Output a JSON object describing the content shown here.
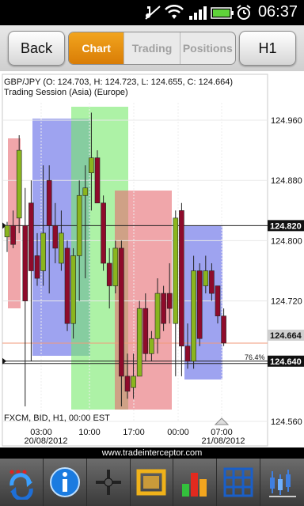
{
  "status": {
    "time": "06:37"
  },
  "toolbar": {
    "back_label": "Back",
    "tabs": [
      {
        "label": "Chart",
        "active": true
      },
      {
        "label": "Trading",
        "active": false
      },
      {
        "label": "Positions",
        "active": false
      }
    ],
    "timeframe_label": "H1"
  },
  "chart": {
    "header_line1": "GBP/JPY (O: 124.703, H: 124.723, L: 124.655, C: 124.664)",
    "header_line2": "Trading Session (Asia) (Europe)",
    "footer_label": "FXCM, BID, H1, 00:00 EST",
    "percent_label": "76.4%",
    "price_current": "124.664",
    "price_marker_upper": "124.820",
    "price_marker_lower": "124.640",
    "y_ticks": [
      "124.960",
      "124.880",
      "124.800",
      "124.720",
      "124.560"
    ],
    "x_ticks": [
      "03:00",
      "10:00",
      "17:00",
      "00:00",
      "07:00"
    ],
    "dates": [
      "20/08/2012",
      "21/08/2012"
    ],
    "colors": {
      "bull": "#8ab51e",
      "bear": "#8e0b2b",
      "asia": "#e66a72",
      "europe": "#5d66e6",
      "session_green": "#77ea6a"
    }
  },
  "chart_data": {
    "type": "candlestick",
    "title": "GBP/JPY",
    "ylim": [
      124.56,
      124.98
    ],
    "y_ticks": [
      124.96,
      124.88,
      124.8,
      124.72,
      124.56
    ],
    "x_ticks": [
      "03:00",
      "10:00",
      "17:00",
      "00:00",
      "07:00"
    ],
    "horizontal_levels": [
      124.82,
      124.664,
      124.64
    ],
    "candles": [
      {
        "o": 124.805,
        "h": 124.825,
        "l": 124.785,
        "c": 124.82
      },
      {
        "o": 124.82,
        "h": 124.84,
        "l": 124.79,
        "c": 124.795
      },
      {
        "o": 124.83,
        "h": 124.94,
        "l": 124.81,
        "c": 124.92
      },
      {
        "o": 124.82,
        "h": 124.87,
        "l": 124.58,
        "c": 124.72
      },
      {
        "o": 124.85,
        "h": 124.88,
        "l": 124.64,
        "c": 124.76
      },
      {
        "o": 124.78,
        "h": 124.81,
        "l": 124.74,
        "c": 124.75
      },
      {
        "o": 124.76,
        "h": 124.9,
        "l": 124.74,
        "c": 124.81
      },
      {
        "o": 124.88,
        "h": 124.9,
        "l": 124.73,
        "c": 124.82
      },
      {
        "o": 124.82,
        "h": 124.85,
        "l": 124.77,
        "c": 124.79
      },
      {
        "o": 124.77,
        "h": 124.84,
        "l": 124.76,
        "c": 124.81
      },
      {
        "o": 124.79,
        "h": 124.8,
        "l": 124.68,
        "c": 124.69
      },
      {
        "o": 124.69,
        "h": 124.79,
        "l": 124.67,
        "c": 124.78
      },
      {
        "o": 124.78,
        "h": 124.88,
        "l": 124.72,
        "c": 124.86
      },
      {
        "o": 124.86,
        "h": 124.9,
        "l": 124.75,
        "c": 124.87
      },
      {
        "o": 124.89,
        "h": 124.97,
        "l": 124.84,
        "c": 124.91
      },
      {
        "o": 124.91,
        "h": 124.92,
        "l": 124.85,
        "c": 124.85
      },
      {
        "o": 124.85,
        "h": 124.86,
        "l": 124.76,
        "c": 124.77
      },
      {
        "o": 124.77,
        "h": 124.79,
        "l": 124.71,
        "c": 124.74
      },
      {
        "o": 124.74,
        "h": 124.8,
        "l": 124.73,
        "c": 124.79
      },
      {
        "o": 124.79,
        "h": 124.8,
        "l": 124.58,
        "c": 124.62
      },
      {
        "o": 124.62,
        "h": 124.65,
        "l": 124.59,
        "c": 124.6
      },
      {
        "o": 124.605,
        "h": 124.65,
        "l": 124.59,
        "c": 124.62
      },
      {
        "o": 124.62,
        "h": 124.72,
        "l": 124.62,
        "c": 124.71
      },
      {
        "o": 124.71,
        "h": 124.73,
        "l": 124.64,
        "c": 124.65
      },
      {
        "o": 124.65,
        "h": 124.68,
        "l": 124.64,
        "c": 124.67
      },
      {
        "o": 124.67,
        "h": 124.75,
        "l": 124.65,
        "c": 124.73
      },
      {
        "o": 124.73,
        "h": 124.74,
        "l": 124.68,
        "c": 124.69
      },
      {
        "o": 124.73,
        "h": 124.77,
        "l": 124.69,
        "c": 124.71
      },
      {
        "o": 124.69,
        "h": 124.84,
        "l": 124.62,
        "c": 124.83
      },
      {
        "o": 124.84,
        "h": 124.85,
        "l": 124.62,
        "c": 124.66
      },
      {
        "o": 124.66,
        "h": 124.69,
        "l": 124.63,
        "c": 124.64
      },
      {
        "o": 124.64,
        "h": 124.78,
        "l": 124.63,
        "c": 124.76
      },
      {
        "o": 124.76,
        "h": 124.77,
        "l": 124.66,
        "c": 124.67
      },
      {
        "o": 124.74,
        "h": 124.78,
        "l": 124.73,
        "c": 124.76
      },
      {
        "o": 124.76,
        "h": 124.77,
        "l": 124.72,
        "c": 124.73
      },
      {
        "o": 124.74,
        "h": 124.74,
        "l": 124.69,
        "c": 124.7
      },
      {
        "o": 124.7,
        "h": 124.71,
        "l": 124.66,
        "c": 124.664
      }
    ]
  },
  "bottom_toolbar": {
    "icons": [
      "refresh-icon",
      "info-icon",
      "crosshair-icon",
      "zoom-frame-icon",
      "indicators-icon",
      "grid-icon",
      "chart-type-icon"
    ]
  },
  "footer": {
    "url": "www.tradeinterceptor.com"
  }
}
